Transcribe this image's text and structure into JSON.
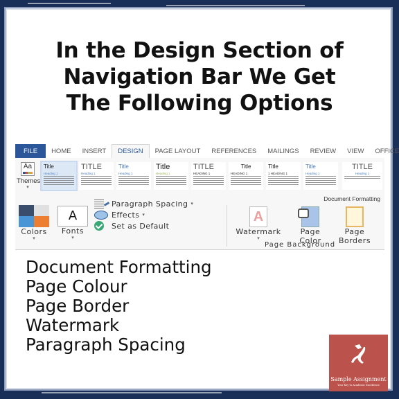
{
  "heading": {
    "lines": [
      "In the Design Section of",
      "Navigation Bar We Get",
      "The Following Options"
    ]
  },
  "ribbon": {
    "tabs": [
      {
        "label": "FILE",
        "state": "file"
      },
      {
        "label": "HOME",
        "state": "normal"
      },
      {
        "label": "INSERT",
        "state": "normal"
      },
      {
        "label": "DESIGN",
        "state": "active"
      },
      {
        "label": "PAGE LAYOUT",
        "state": "normal"
      },
      {
        "label": "REFERENCES",
        "state": "normal"
      },
      {
        "label": "MAILINGS",
        "state": "normal"
      },
      {
        "label": "REVIEW",
        "state": "normal"
      },
      {
        "label": "VIEW",
        "state": "normal"
      },
      {
        "label": "OFFICE TAB",
        "state": "normal"
      }
    ],
    "themes_label": "Themes",
    "style_gallery": [
      {
        "title": "Title",
        "heading": "Heading 1"
      },
      {
        "title": "TITLE",
        "heading": "Heading 1"
      },
      {
        "title": "Title",
        "heading": "Heading 1"
      },
      {
        "title": "Title",
        "heading": "Heading 1"
      },
      {
        "title": "TITLE",
        "heading": "HEADING 1"
      },
      {
        "title": "Title",
        "heading": "HEADING 1"
      },
      {
        "title": "Title",
        "heading": "1 HEADING 1"
      },
      {
        "title": "Title",
        "heading": "Heading 1"
      },
      {
        "title": "TITLE",
        "heading": "Heading 1"
      }
    ],
    "colors_label": "Colors",
    "fonts_label": "Fonts",
    "fonts_glyph": "A",
    "paragraph_spacing_label": "Paragraph Spacing",
    "effects_label": "Effects",
    "set_default_label": "Set as Default",
    "document_formatting_label": "Document Formatting",
    "watermark_label": "Watermark",
    "watermark_glyph": "A",
    "page_color_label_1": "Page",
    "page_color_label_2": "Color",
    "page_borders_label_1": "Page",
    "page_borders_label_2": "Borders",
    "page_background_group": "Page Background",
    "dropdown_caret": "▾"
  },
  "options": [
    "Document Formatting",
    "Page Colour",
    "Page Border",
    "Watermark",
    "Paragraph Spacing"
  ],
  "logo": {
    "name": "Sample Assignment",
    "tagline": "Your Key to Academic Excellence"
  },
  "colors": {
    "frame": "#1a2f57",
    "file_tab": "#2b579a",
    "logo_bg": "#bb524c"
  }
}
